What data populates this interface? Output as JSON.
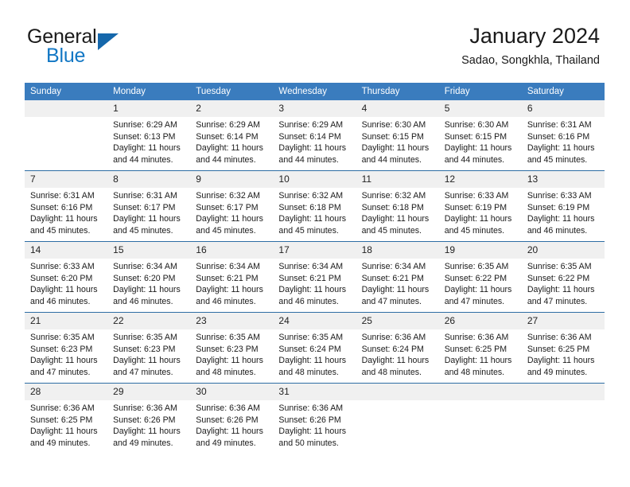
{
  "brand": {
    "name_part1": "General",
    "name_part2": "Blue",
    "triangle_color": "#1567ab",
    "blue_color": "#1277c4"
  },
  "header": {
    "title": "January 2024",
    "subtitle": "Sadao, Songkhla, Thailand",
    "header_bg": "#3a7cbe",
    "row_divider": "#2e6da4",
    "datenum_bg": "#f0f0f0"
  },
  "weekday_headers": [
    "Sunday",
    "Monday",
    "Tuesday",
    "Wednesday",
    "Thursday",
    "Friday",
    "Saturday"
  ],
  "weeks": [
    {
      "days": [
        {
          "date": "",
          "sunrise": "",
          "sunset": "",
          "daylight_line1": "",
          "daylight_line2": "",
          "empty": true
        },
        {
          "date": "1",
          "sunrise": "Sunrise: 6:29 AM",
          "sunset": "Sunset: 6:13 PM",
          "daylight_line1": "Daylight: 11 hours",
          "daylight_line2": "and 44 minutes."
        },
        {
          "date": "2",
          "sunrise": "Sunrise: 6:29 AM",
          "sunset": "Sunset: 6:14 PM",
          "daylight_line1": "Daylight: 11 hours",
          "daylight_line2": "and 44 minutes."
        },
        {
          "date": "3",
          "sunrise": "Sunrise: 6:29 AM",
          "sunset": "Sunset: 6:14 PM",
          "daylight_line1": "Daylight: 11 hours",
          "daylight_line2": "and 44 minutes."
        },
        {
          "date": "4",
          "sunrise": "Sunrise: 6:30 AM",
          "sunset": "Sunset: 6:15 PM",
          "daylight_line1": "Daylight: 11 hours",
          "daylight_line2": "and 44 minutes."
        },
        {
          "date": "5",
          "sunrise": "Sunrise: 6:30 AM",
          "sunset": "Sunset: 6:15 PM",
          "daylight_line1": "Daylight: 11 hours",
          "daylight_line2": "and 44 minutes."
        },
        {
          "date": "6",
          "sunrise": "Sunrise: 6:31 AM",
          "sunset": "Sunset: 6:16 PM",
          "daylight_line1": "Daylight: 11 hours",
          "daylight_line2": "and 45 minutes."
        }
      ]
    },
    {
      "days": [
        {
          "date": "7",
          "sunrise": "Sunrise: 6:31 AM",
          "sunset": "Sunset: 6:16 PM",
          "daylight_line1": "Daylight: 11 hours",
          "daylight_line2": "and 45 minutes."
        },
        {
          "date": "8",
          "sunrise": "Sunrise: 6:31 AM",
          "sunset": "Sunset: 6:17 PM",
          "daylight_line1": "Daylight: 11 hours",
          "daylight_line2": "and 45 minutes."
        },
        {
          "date": "9",
          "sunrise": "Sunrise: 6:32 AM",
          "sunset": "Sunset: 6:17 PM",
          "daylight_line1": "Daylight: 11 hours",
          "daylight_line2": "and 45 minutes."
        },
        {
          "date": "10",
          "sunrise": "Sunrise: 6:32 AM",
          "sunset": "Sunset: 6:18 PM",
          "daylight_line1": "Daylight: 11 hours",
          "daylight_line2": "and 45 minutes."
        },
        {
          "date": "11",
          "sunrise": "Sunrise: 6:32 AM",
          "sunset": "Sunset: 6:18 PM",
          "daylight_line1": "Daylight: 11 hours",
          "daylight_line2": "and 45 minutes."
        },
        {
          "date": "12",
          "sunrise": "Sunrise: 6:33 AM",
          "sunset": "Sunset: 6:19 PM",
          "daylight_line1": "Daylight: 11 hours",
          "daylight_line2": "and 45 minutes."
        },
        {
          "date": "13",
          "sunrise": "Sunrise: 6:33 AM",
          "sunset": "Sunset: 6:19 PM",
          "daylight_line1": "Daylight: 11 hours",
          "daylight_line2": "and 46 minutes."
        }
      ]
    },
    {
      "days": [
        {
          "date": "14",
          "sunrise": "Sunrise: 6:33 AM",
          "sunset": "Sunset: 6:20 PM",
          "daylight_line1": "Daylight: 11 hours",
          "daylight_line2": "and 46 minutes."
        },
        {
          "date": "15",
          "sunrise": "Sunrise: 6:34 AM",
          "sunset": "Sunset: 6:20 PM",
          "daylight_line1": "Daylight: 11 hours",
          "daylight_line2": "and 46 minutes."
        },
        {
          "date": "16",
          "sunrise": "Sunrise: 6:34 AM",
          "sunset": "Sunset: 6:21 PM",
          "daylight_line1": "Daylight: 11 hours",
          "daylight_line2": "and 46 minutes."
        },
        {
          "date": "17",
          "sunrise": "Sunrise: 6:34 AM",
          "sunset": "Sunset: 6:21 PM",
          "daylight_line1": "Daylight: 11 hours",
          "daylight_line2": "and 46 minutes."
        },
        {
          "date": "18",
          "sunrise": "Sunrise: 6:34 AM",
          "sunset": "Sunset: 6:21 PM",
          "daylight_line1": "Daylight: 11 hours",
          "daylight_line2": "and 47 minutes."
        },
        {
          "date": "19",
          "sunrise": "Sunrise: 6:35 AM",
          "sunset": "Sunset: 6:22 PM",
          "daylight_line1": "Daylight: 11 hours",
          "daylight_line2": "and 47 minutes."
        },
        {
          "date": "20",
          "sunrise": "Sunrise: 6:35 AM",
          "sunset": "Sunset: 6:22 PM",
          "daylight_line1": "Daylight: 11 hours",
          "daylight_line2": "and 47 minutes."
        }
      ]
    },
    {
      "days": [
        {
          "date": "21",
          "sunrise": "Sunrise: 6:35 AM",
          "sunset": "Sunset: 6:23 PM",
          "daylight_line1": "Daylight: 11 hours",
          "daylight_line2": "and 47 minutes."
        },
        {
          "date": "22",
          "sunrise": "Sunrise: 6:35 AM",
          "sunset": "Sunset: 6:23 PM",
          "daylight_line1": "Daylight: 11 hours",
          "daylight_line2": "and 47 minutes."
        },
        {
          "date": "23",
          "sunrise": "Sunrise: 6:35 AM",
          "sunset": "Sunset: 6:23 PM",
          "daylight_line1": "Daylight: 11 hours",
          "daylight_line2": "and 48 minutes."
        },
        {
          "date": "24",
          "sunrise": "Sunrise: 6:35 AM",
          "sunset": "Sunset: 6:24 PM",
          "daylight_line1": "Daylight: 11 hours",
          "daylight_line2": "and 48 minutes."
        },
        {
          "date": "25",
          "sunrise": "Sunrise: 6:36 AM",
          "sunset": "Sunset: 6:24 PM",
          "daylight_line1": "Daylight: 11 hours",
          "daylight_line2": "and 48 minutes."
        },
        {
          "date": "26",
          "sunrise": "Sunrise: 6:36 AM",
          "sunset": "Sunset: 6:25 PM",
          "daylight_line1": "Daylight: 11 hours",
          "daylight_line2": "and 48 minutes."
        },
        {
          "date": "27",
          "sunrise": "Sunrise: 6:36 AM",
          "sunset": "Sunset: 6:25 PM",
          "daylight_line1": "Daylight: 11 hours",
          "daylight_line2": "and 49 minutes."
        }
      ]
    },
    {
      "days": [
        {
          "date": "28",
          "sunrise": "Sunrise: 6:36 AM",
          "sunset": "Sunset: 6:25 PM",
          "daylight_line1": "Daylight: 11 hours",
          "daylight_line2": "and 49 minutes."
        },
        {
          "date": "29",
          "sunrise": "Sunrise: 6:36 AM",
          "sunset": "Sunset: 6:26 PM",
          "daylight_line1": "Daylight: 11 hours",
          "daylight_line2": "and 49 minutes."
        },
        {
          "date": "30",
          "sunrise": "Sunrise: 6:36 AM",
          "sunset": "Sunset: 6:26 PM",
          "daylight_line1": "Daylight: 11 hours",
          "daylight_line2": "and 49 minutes."
        },
        {
          "date": "31",
          "sunrise": "Sunrise: 6:36 AM",
          "sunset": "Sunset: 6:26 PM",
          "daylight_line1": "Daylight: 11 hours",
          "daylight_line2": "and 50 minutes."
        },
        {
          "date": "",
          "sunrise": "",
          "sunset": "",
          "daylight_line1": "",
          "daylight_line2": "",
          "empty": true
        },
        {
          "date": "",
          "sunrise": "",
          "sunset": "",
          "daylight_line1": "",
          "daylight_line2": "",
          "empty": true
        },
        {
          "date": "",
          "sunrise": "",
          "sunset": "",
          "daylight_line1": "",
          "daylight_line2": "",
          "empty": true
        }
      ]
    }
  ]
}
